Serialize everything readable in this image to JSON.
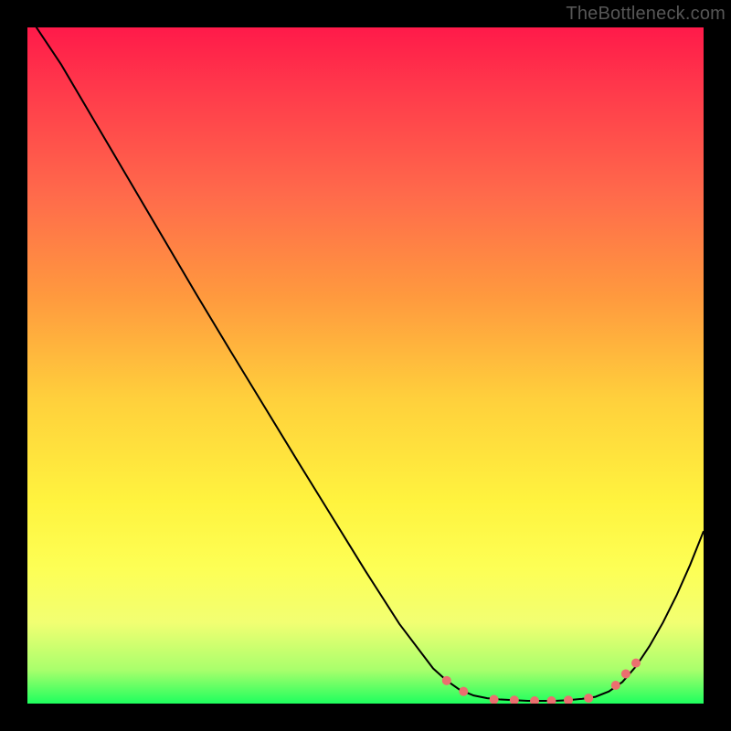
{
  "watermark": "TheBottleneck.com",
  "chart_data": {
    "type": "line",
    "note": "Axes are not labeled; values below are fractional positions in [0,1] where x=0 is left edge, x=1 is right edge; y is the curve height as a fraction of plot height with 0 = bottom (green, optimal) and 1 = top (red, worst).",
    "x": [
      0.0,
      0.05,
      0.1,
      0.15,
      0.2,
      0.25,
      0.3,
      0.35,
      0.4,
      0.45,
      0.5,
      0.55,
      0.6,
      0.62,
      0.64,
      0.66,
      0.68,
      0.7,
      0.72,
      0.74,
      0.76,
      0.78,
      0.8,
      0.82,
      0.84,
      0.86,
      0.88,
      0.9,
      0.92,
      0.94,
      0.96,
      0.98,
      1.0
    ],
    "y": [
      1.02,
      0.945,
      0.86,
      0.775,
      0.69,
      0.605,
      0.522,
      0.44,
      0.358,
      0.277,
      0.196,
      0.118,
      0.052,
      0.034,
      0.02,
      0.012,
      0.008,
      0.006,
      0.005,
      0.004,
      0.004,
      0.004,
      0.005,
      0.007,
      0.01,
      0.018,
      0.032,
      0.055,
      0.085,
      0.12,
      0.16,
      0.205,
      0.255
    ],
    "markers": {
      "x": [
        0.62,
        0.645,
        0.69,
        0.72,
        0.75,
        0.775,
        0.8,
        0.83,
        0.87,
        0.885,
        0.9
      ],
      "y": [
        0.034,
        0.018,
        0.006,
        0.005,
        0.004,
        0.004,
        0.005,
        0.008,
        0.027,
        0.044,
        0.06
      ]
    },
    "title": "",
    "xlabel": "",
    "ylabel": "",
    "xlim": [
      0,
      1
    ],
    "ylim": [
      0,
      1
    ]
  }
}
